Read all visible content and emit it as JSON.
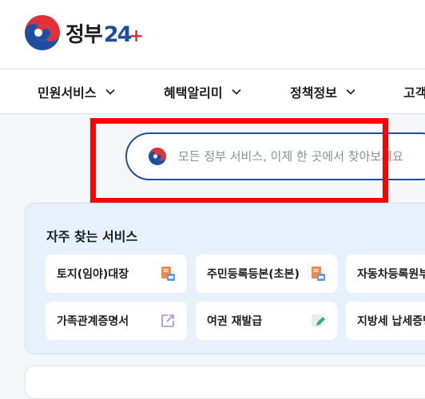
{
  "header": {
    "logo_text": "정부",
    "logo_num": "24",
    "logo_plus": "+"
  },
  "nav": {
    "items": [
      {
        "label": "민원서비스"
      },
      {
        "label": "혜택알리미"
      },
      {
        "label": "정책정보"
      },
      {
        "label": "고객"
      }
    ]
  },
  "search": {
    "placeholder": "모든 정부 서비스, 이제 한 곳에서 찾아보세요"
  },
  "frequent": {
    "title": "자주 찾는 서비스",
    "cards": [
      {
        "label": "토지(임야)대장",
        "icon": "document-print-icon"
      },
      {
        "label": "주민등록등본(초본)",
        "icon": "document-print-icon"
      },
      {
        "label": "자동차등록원부",
        "icon": "document-print-icon"
      },
      {
        "label": "가족관계증명서",
        "icon": "external-link-icon"
      },
      {
        "label": "여권 재발급",
        "icon": "edit-document-icon"
      },
      {
        "label": "지방세 납세증명",
        "icon": "document-print-icon"
      }
    ]
  },
  "colors": {
    "brand_blue": "#1e4ea1",
    "brand_red": "#e0313a",
    "panel_bg": "#e6f1fb",
    "highlight": "#ff0000"
  }
}
